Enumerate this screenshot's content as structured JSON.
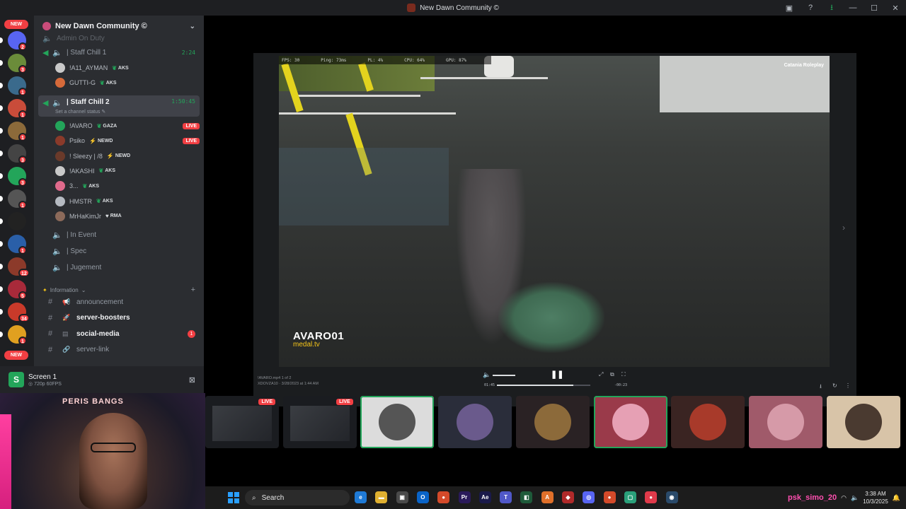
{
  "window": {
    "title": "New Dawn Community ©",
    "controls": [
      "feedback",
      "help",
      "download",
      "minimize",
      "maximize",
      "close"
    ]
  },
  "rail": {
    "new_badges": [
      "NEW",
      "NEW"
    ],
    "servers": [
      {
        "color": "#5865f2",
        "badge": "2"
      },
      {
        "color": "#6b8c3a",
        "badge": "3"
      },
      {
        "color": "#3a6a8c",
        "badge": "1"
      },
      {
        "color": "#c94c3a",
        "badge": "1"
      },
      {
        "color": "#8c6a3a",
        "badge": "1"
      },
      {
        "color": "#444444",
        "badge": "3"
      },
      {
        "color": "#23a55a",
        "badge": "3"
      },
      {
        "color": "#555555",
        "badge": "1"
      },
      {
        "color": "#222222",
        "badge": ""
      },
      {
        "color": "#2a5fa8",
        "badge": "1"
      },
      {
        "color": "#8c3a2a",
        "badge": "12"
      },
      {
        "color": "#a82a3a",
        "badge": "5"
      },
      {
        "color": "#c93a2a",
        "badge": "34"
      },
      {
        "color": "#e0a020",
        "badge": "1"
      }
    ]
  },
  "sidebar": {
    "server_name": "New Dawn Community ©",
    "scrolled_top_label": "Admin On Duty",
    "voice_channels": [
      {
        "name": "| Staff Chill 1",
        "timer": "2:24"
      },
      {
        "name": "| Staff Chill 2",
        "timer": "1:50:45",
        "status": "Set a channel status"
      },
      {
        "name": "| In Event"
      },
      {
        "name": "| Spec"
      },
      {
        "name": "| Jugement"
      }
    ],
    "chill1_users": [
      {
        "name": "!A11_AYMAN",
        "tag": "AKS",
        "color": "#c9c9c9"
      },
      {
        "name": "GUTTI-G",
        "tag": "AKS",
        "color": "#d66a3a"
      }
    ],
    "chill2_users": [
      {
        "name": "!AVARO",
        "tag": "GAZA",
        "live": "LIVE",
        "color": "#23a55a"
      },
      {
        "name": "Psiko",
        "tag": "NEWD",
        "live": "LIVE",
        "color": "#8a3a2a"
      },
      {
        "name": "! Sleezy | /8",
        "tag": "NEWD",
        "color": "#6a3a2a"
      },
      {
        "name": "!AKASHI",
        "tag": "AKS",
        "color": "#c9c9c9"
      },
      {
        "name": "3...",
        "tag": "AKS",
        "color": "#e06a8c"
      },
      {
        "name": "HMSTR",
        "tag": "AKS",
        "color": "#b5bac1"
      },
      {
        "name": "MrHaKimJr",
        "tag": "RMA",
        "color": "#8c6a5a"
      }
    ],
    "category": "Information",
    "text_channels": [
      {
        "name": "announcement",
        "bold": false
      },
      {
        "name": "server-boosters",
        "bold": true
      },
      {
        "name": "social-media",
        "bold": true,
        "unread": "1"
      },
      {
        "name": "server-link",
        "bold": false
      }
    ]
  },
  "voice_bar": {
    "title": "Screen 1",
    "subtitle": "720p 60FPS"
  },
  "stream": {
    "hud": {
      "fps": "FPS: 30",
      "ping": "Ping: 73ms",
      "pl": "PL: 4%",
      "cpu": "CPU: 64%",
      "gpu": "GPU: 87%"
    },
    "brand": "Catania Roleplay",
    "watermark_user": "AVARO01",
    "watermark_site": "medal.tv",
    "file_line1": "!AVARO.mp4 1 of 2",
    "file_line2": "XDOVZA10 · 3/28/2023 at 1:44 AM",
    "time_current": "01:45",
    "time_remaining": "-00:23",
    "progress": 0.82,
    "volume": 0.6
  },
  "tiles": [
    {
      "bg": "#1a1c20",
      "live": "LIVE",
      "avatar": ""
    },
    {
      "bg": "#1a1c20",
      "live": "LIVE",
      "avatar": ""
    },
    {
      "bg": "#dcdcdc",
      "live": "",
      "avatar": "#555555",
      "selected": true
    },
    {
      "bg": "#2a2d3a",
      "live": "",
      "avatar": "#6a5a8c"
    },
    {
      "bg": "#2a2224",
      "live": "",
      "avatar": "#8c6a3a"
    },
    {
      "bg": "#9a3a4a",
      "live": "",
      "avatar": "#e6a0b4",
      "selected": true
    },
    {
      "bg": "#3a2422",
      "live": "",
      "avatar": "#a83a2a"
    },
    {
      "bg": "#a05a6a",
      "live": "",
      "avatar": "#d69aa8"
    },
    {
      "bg": "#d8c4a8",
      "live": "",
      "avatar": "#4a3a30"
    }
  ],
  "webcam": {
    "sign": "PERIS BANGS"
  },
  "taskbar": {
    "search_placeholder": "Search",
    "apps": [
      {
        "label": "e",
        "color": "#1f7ad6"
      },
      {
        "label": "▬",
        "color": "#e0b030"
      },
      {
        "label": "▣",
        "color": "#4a4a4a"
      },
      {
        "label": "O",
        "color": "#0a64c8"
      },
      {
        "label": "●",
        "color": "#d44a2a"
      },
      {
        "label": "Pr",
        "color": "#2a1a5a"
      },
      {
        "label": "Ae",
        "color": "#1a1a4a"
      },
      {
        "label": "T",
        "color": "#5058c8"
      },
      {
        "label": "◧",
        "color": "#1e5a3a"
      },
      {
        "label": "A",
        "color": "#e0702a"
      },
      {
        "label": "◆",
        "color": "#b02a2a"
      },
      {
        "label": "◎",
        "color": "#5865f2"
      },
      {
        "label": "●",
        "color": "#d44a2a"
      },
      {
        "label": "▢",
        "color": "#2aa07a"
      },
      {
        "label": "●",
        "color": "#e03a4a"
      },
      {
        "label": "◉",
        "color": "#2a4a6a"
      }
    ],
    "tray_user": "psk_simo_20",
    "time": "3:38 AM",
    "date": "10/3/2025"
  }
}
